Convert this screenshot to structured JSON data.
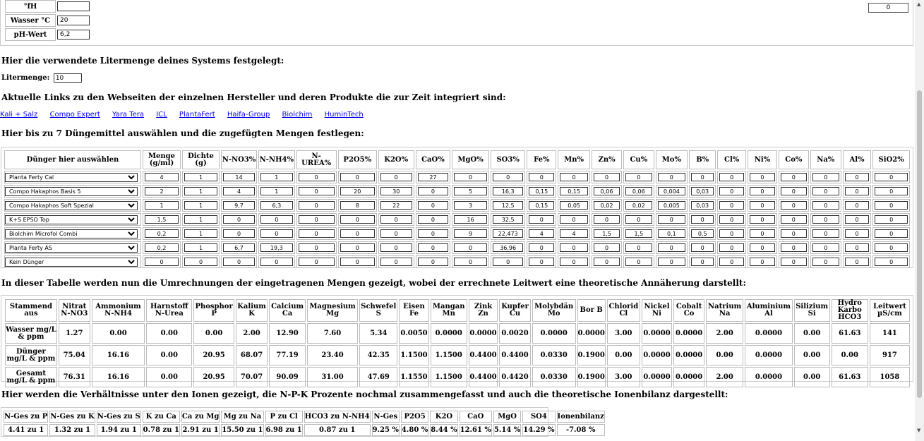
{
  "water": {
    "rows": [
      {
        "label": "°fH",
        "value": ""
      },
      {
        "label": "Wasser °C",
        "value": "20"
      },
      {
        "label": "pH-Wert",
        "value": "6,2"
      }
    ],
    "right_value": "0"
  },
  "liter": {
    "heading": "Hier die verwendete Litermenge deines Systems festgelegt:",
    "label": "Litermenge:",
    "value": "10"
  },
  "links": {
    "heading": "Aktuelle Links zu den Webseiten der einzelnen Hersteller und deren Produkte die zur Zeit integriert sind:",
    "items": [
      "Kali + Salz",
      "Compo Expert",
      "Yara Tera",
      "ICL",
      "PlantaFert",
      "Haifa-Group",
      "Biolchim",
      "HuminTech"
    ]
  },
  "dunger": {
    "heading": "Hier bis zu 7 Düngemittel auswählen und die zugefügten Mengen festlegen:",
    "headers": [
      "Dünger hier auswählen",
      "Menge (g/ml)",
      "Dichte (g)",
      "N-NO3%",
      "N-NH4%",
      "N-UREA%",
      "P2O5%",
      "K2O%",
      "CaO%",
      "MgO%",
      "SO3%",
      "Fe%",
      "Mn%",
      "Zn%",
      "Cu%",
      "Mo%",
      "B%",
      "Cl%",
      "Ni%",
      "Co%",
      "Na%",
      "Al%",
      "SiO2%"
    ],
    "rows": [
      {
        "product": "Planta Ferty Cal",
        "values": [
          "4",
          "1",
          "14",
          "1",
          "0",
          "0",
          "0",
          "27",
          "0",
          "0",
          "0",
          "0",
          "0",
          "0",
          "0",
          "0",
          "0",
          "0",
          "0",
          "0",
          "0",
          "0"
        ]
      },
      {
        "product": "Compo Hakaphos Basis 5",
        "values": [
          "2",
          "1",
          "4",
          "1",
          "0",
          "20",
          "30",
          "0",
          "5",
          "16,3",
          "0,15",
          "0,15",
          "0,06",
          "0,06",
          "0,004",
          "0,03",
          "0",
          "0",
          "0",
          "0",
          "0",
          "0"
        ]
      },
      {
        "product": "Compo Hakaphos Soft Spezial",
        "values": [
          "1",
          "1",
          "9,7",
          "6,3",
          "0",
          "8",
          "22",
          "0",
          "3",
          "12,5",
          "0,15",
          "0,05",
          "0,02",
          "0,02",
          "0,005",
          "0,03",
          "0",
          "0",
          "0",
          "0",
          "0",
          "0"
        ]
      },
      {
        "product": "K+S EPSO Top",
        "values": [
          "1,5",
          "1",
          "0",
          "0",
          "0",
          "0",
          "0",
          "0",
          "16",
          "32,5",
          "0",
          "0",
          "0",
          "0",
          "0",
          "0",
          "0",
          "0",
          "0",
          "0",
          "0",
          "0"
        ]
      },
      {
        "product": "Biolchim Microfol Combi",
        "values": [
          "0,2",
          "1",
          "0",
          "0",
          "0",
          "0",
          "0",
          "0",
          "9",
          "22,473",
          "4",
          "4",
          "1,5",
          "1,5",
          "0,1",
          "0,5",
          "0",
          "0",
          "0",
          "0",
          "0",
          "0"
        ]
      },
      {
        "product": "Planta Ferty AS",
        "values": [
          "0,2",
          "1",
          "6,7",
          "19,3",
          "0",
          "0",
          "0",
          "0",
          "0",
          "36,96",
          "0",
          "0",
          "0",
          "0",
          "0",
          "0",
          "0",
          "0",
          "0",
          "0",
          "0",
          "0"
        ]
      },
      {
        "product": "Kein Dünger",
        "values": [
          "0",
          "0",
          "0",
          "0",
          "0",
          "0",
          "0",
          "0",
          "0",
          "0",
          "0",
          "0",
          "0",
          "0",
          "0",
          "0",
          "0",
          "0",
          "0",
          "0",
          "0",
          "0"
        ]
      }
    ]
  },
  "conversion": {
    "heading": "In dieser Tabelle werden nun die Umrechnungen der eingetragenen Mengen gezeigt, wobei der errechnete Leitwert eine theoretische Annäherung darstellt:",
    "headers": [
      "Stammend aus",
      "Nitrat N-NO3",
      "Ammonium N-NH4",
      "Harnstoff N-Urea",
      "Phosphor P",
      "Kalium K",
      "Calcium Ca",
      "Magnesium Mg",
      "Schwefel S",
      "Eisen Fe",
      "Mangan Mn",
      "Zink Zn",
      "Kupfer Cu",
      "Molybdän Mo",
      "Bor B",
      "Chlorid Cl",
      "Nickel Ni",
      "Cobalt Co",
      "Natrium Na",
      "Aluminium Al",
      "Silizium Si",
      "Hydro Karbo HCO3",
      "Leitwert µS/cm"
    ],
    "rows": [
      {
        "label": "Wasser mg/L & ppm",
        "values": [
          "1.27",
          "0.00",
          "0.00",
          "0.00",
          "2.00",
          "12.90",
          "7.60",
          "5.34",
          "0.0050",
          "0.0000",
          "0.0000",
          "0.0020",
          "0.0000",
          "0.0000",
          "3.00",
          "0.0000",
          "0.0000",
          "2.00",
          "0.0000",
          "0.00",
          "61.63",
          "141"
        ]
      },
      {
        "label": "Dünger mg/L & ppm",
        "values": [
          "75.04",
          "16.16",
          "0.00",
          "20.95",
          "68.07",
          "77.19",
          "23.40",
          "42.35",
          "1.1500",
          "1.1500",
          "0.4400",
          "0.4400",
          "0.0330",
          "0.1900",
          "0.00",
          "0.0000",
          "0.0000",
          "0.00",
          "0.0000",
          "0.00",
          "0.00",
          "917"
        ]
      },
      {
        "label": "Gesamt mg/L & ppm",
        "values": [
          "76.31",
          "16.16",
          "0.00",
          "20.95",
          "70.07",
          "90.09",
          "31.00",
          "47.69",
          "1.1550",
          "1.1500",
          "0.4400",
          "0.4420",
          "0.0330",
          "0.1900",
          "3.00",
          "0.0000",
          "0.0000",
          "2.00",
          "0.0000",
          "0.00",
          "61.63",
          "1058"
        ]
      }
    ]
  },
  "ratios": {
    "heading": "Hier werden die Verhältnisse unter den Ionen gezeigt, die N-P-K Prozente nochmal zusammengefasst und auch die theoretische Ionenbilanz dargestellt:",
    "headers": [
      "N-Ges zu P",
      "N-Ges zu K",
      "N-Ges zu S",
      "K zu Ca",
      "Ca zu Mg",
      "Mg zu Na",
      "P zu Cl",
      "HCO3 zu N-NH4",
      "N-Ges",
      "P2O5",
      "K2O",
      "CaO",
      "MgO",
      "SO4",
      "Ionenbilanz"
    ],
    "values": [
      "4.41 zu 1",
      "1.32 zu 1",
      "1.94 zu 1",
      "0.78 zu 1",
      "2.91 zu 1",
      "15.50 zu 1",
      "6.98 zu 1",
      "0.87 zu 1",
      "9.25 %",
      "4.80 %",
      "8.44 %",
      "12.61 %",
      "5.14 %",
      "14.29 %",
      "-7.08 %"
    ]
  }
}
